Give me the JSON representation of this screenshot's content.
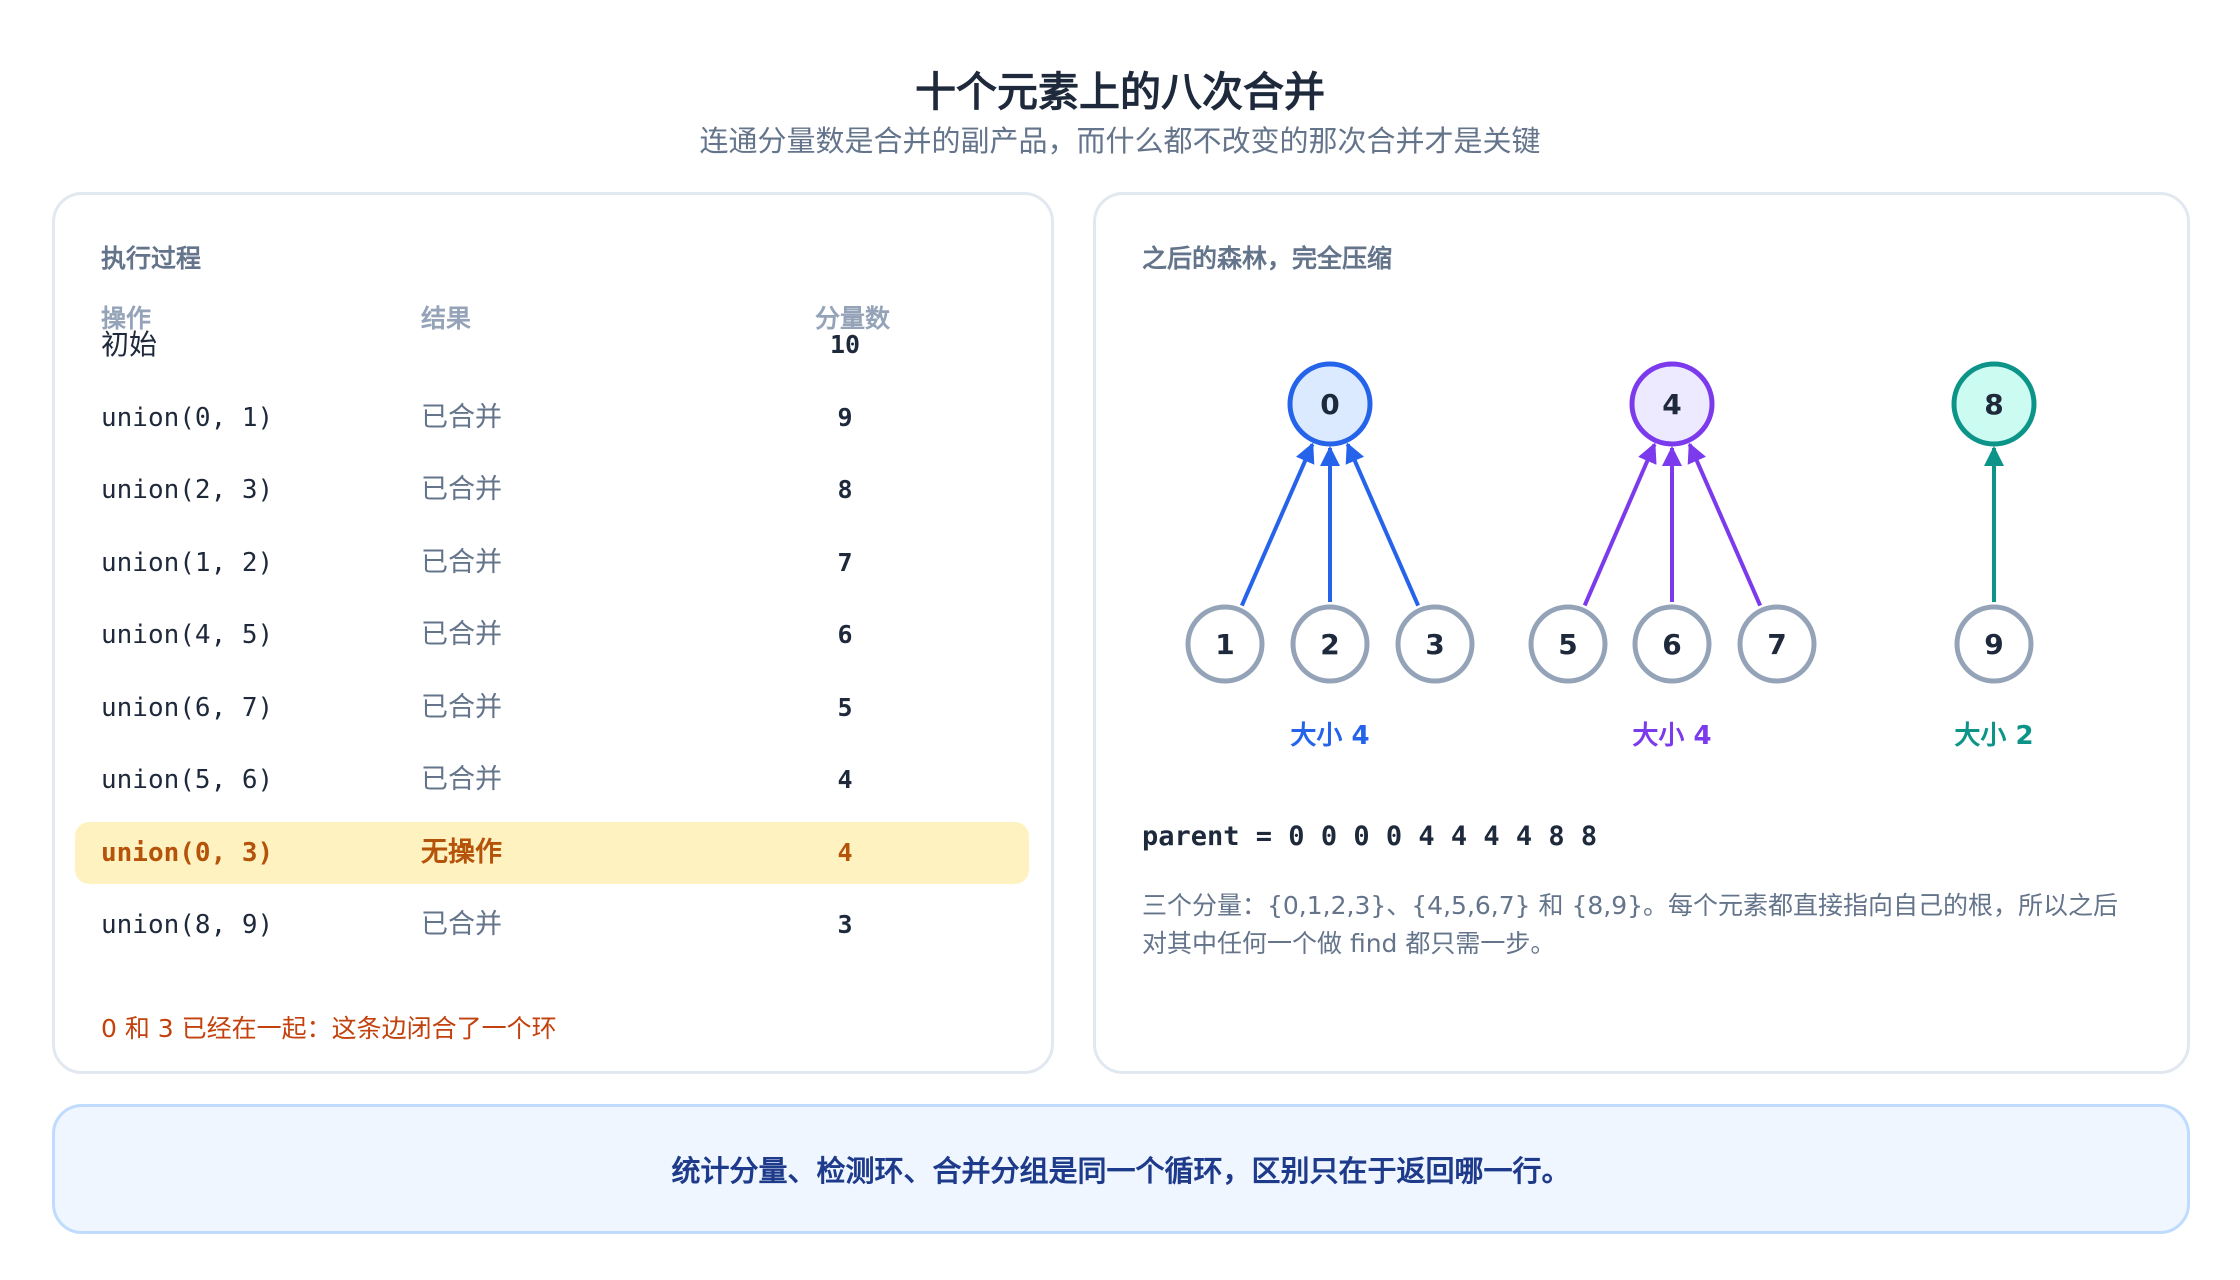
{
  "title": "十个元素上的八次合并",
  "subtitle": "连通分量数是合并的副产品，而什么都不改变的那次合并才是关键",
  "execution": {
    "title": "执行过程",
    "headers": {
      "op": "操作",
      "result": "结果",
      "count": "分量数"
    },
    "rows": [
      {
        "op": "初始",
        "result": "",
        "count": "10",
        "code": false,
        "highlight": false
      },
      {
        "op": "union(0, 1)",
        "result": "已合并",
        "count": "9",
        "code": true,
        "highlight": false
      },
      {
        "op": "union(2, 3)",
        "result": "已合并",
        "count": "8",
        "code": true,
        "highlight": false
      },
      {
        "op": "union(1, 2)",
        "result": "已合并",
        "count": "7",
        "code": true,
        "highlight": false
      },
      {
        "op": "union(4, 5)",
        "result": "已合并",
        "count": "6",
        "code": true,
        "highlight": false
      },
      {
        "op": "union(6, 7)",
        "result": "已合并",
        "count": "5",
        "code": true,
        "highlight": false
      },
      {
        "op": "union(5, 6)",
        "result": "已合并",
        "count": "4",
        "code": true,
        "highlight": false
      },
      {
        "op": "union(0, 3)",
        "result": "无操作",
        "count": "4",
        "code": true,
        "highlight": true
      },
      {
        "op": "union(8, 9)",
        "result": "已合并",
        "count": "3",
        "code": true,
        "highlight": false
      }
    ],
    "note": "0 和 3 已经在一起：这条边闭合了一个环",
    "highlight_color": "#b45309"
  },
  "forest": {
    "title": "之后的森林，完全压缩",
    "trees": [
      {
        "root": "0",
        "children": [
          "1",
          "2",
          "3"
        ],
        "size_label": "大小 4",
        "color": "#2563eb",
        "fill": "#dbeafe"
      },
      {
        "root": "4",
        "children": [
          "5",
          "6",
          "7"
        ],
        "size_label": "大小 4",
        "color": "#7c3aed",
        "fill": "#ede9fe"
      },
      {
        "root": "8",
        "children": [
          "9"
        ],
        "size_label": "大小 2",
        "color": "#0d9488",
        "fill": "#ccfbf1"
      }
    ],
    "child_color": "#94a3b8",
    "parent_label": "parent =",
    "parent_values": [
      "0",
      "0",
      "0",
      "0",
      "4",
      "4",
      "4",
      "4",
      "8",
      "8"
    ],
    "description": "三个分量：{0,1,2,3}、{4,5,6,7} 和 {8,9}。每个元素都直接指向自己的根，所以之后对其中任何一个做 find 都只需一步。"
  },
  "banner": "统计分量、检测环、合并分组是同一个循环，区别只在于返回哪一行。"
}
